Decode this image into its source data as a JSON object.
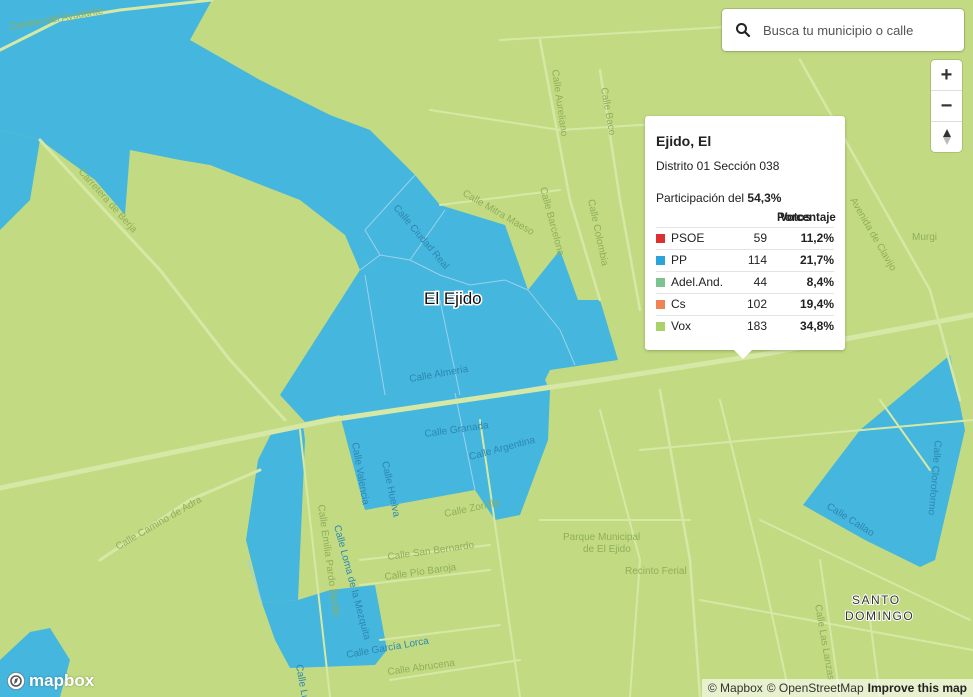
{
  "colors": {
    "land": "#c2db83",
    "pp_area": "#45b6de",
    "road": "#d6e8a6",
    "road_label": "#8fae5b"
  },
  "search": {
    "placeholder": "Busca tu municipio o calle",
    "icon": "search-icon"
  },
  "zoom_controls": {
    "in": "+",
    "out": "−",
    "compass": "compass-icon"
  },
  "popup": {
    "municipality": "Ejido, El",
    "section": "Distrito 01 Sección 038",
    "participation_label": "Participación del",
    "participation_value": "54,3%",
    "header_votes": "Votos",
    "header_percent": "Porcentaje",
    "parties": [
      {
        "name": "PSOE",
        "votes": "59",
        "percent": "11,2%",
        "color": "#dd3131"
      },
      {
        "name": "PP",
        "votes": "114",
        "percent": "21,7%",
        "color": "#2ba4dc"
      },
      {
        "name": "Adel.And.",
        "votes": "44",
        "percent": "8,4%",
        "color": "#7cc38f"
      },
      {
        "name": "Cs",
        "votes": "102",
        "percent": "19,4%",
        "color": "#ee8455"
      },
      {
        "name": "Vox",
        "votes": "183",
        "percent": "34,8%",
        "color": "#a9d36a"
      }
    ]
  },
  "map_labels": {
    "town": "El Ejido",
    "santo": "SANTO",
    "domingo": "DOMINGO",
    "murgi": "Murgi",
    "parque_1": "Parque Municipal",
    "parque_2": "de El Ejido",
    "recinto": "Recinto Ferial",
    "streets": {
      "ayudante": "Camino del Ayudante",
      "berja": "Carretera de Berja",
      "aureliano": "Calle Aureliano",
      "baco": "Calle Baco",
      "ciudad_real": "Calle Ciudad Real",
      "mitra": "Calle Mitra Maeso",
      "barcelona": "Calle Barcelona",
      "colombia": "Calle Colombia",
      "almeria": "Calle Almería",
      "granada": "Calle Granada",
      "argentina": "Calle Argentina",
      "huelva": "Calle Huelva",
      "valencia": "Calle Valencia",
      "zorrilla": "Calle Zorrilla",
      "adra": "Calle Camino de Adra",
      "emilia": "Calle Emilia Pardo Bazán",
      "loma": "Calle Loma de la Mezquita",
      "san_bernardo": "Calle San Bernardo",
      "pio": "Calle Pío Baroja",
      "garcia": "Calle García Lorca",
      "abrucena": "Calle Abrucena",
      "lucas": "Calle Lucas",
      "callao": "Calle Callao",
      "cloroformo": "Calle Cloroformo",
      "las_lanzas": "Calle Las Lanzas",
      "clavijo": "Avenida de Clavijo"
    }
  },
  "attribution": {
    "mapbox": "© Mapbox",
    "osm": "© OpenStreetMap",
    "improve": "Improve this map"
  },
  "logo": {
    "text": "mapbox"
  }
}
